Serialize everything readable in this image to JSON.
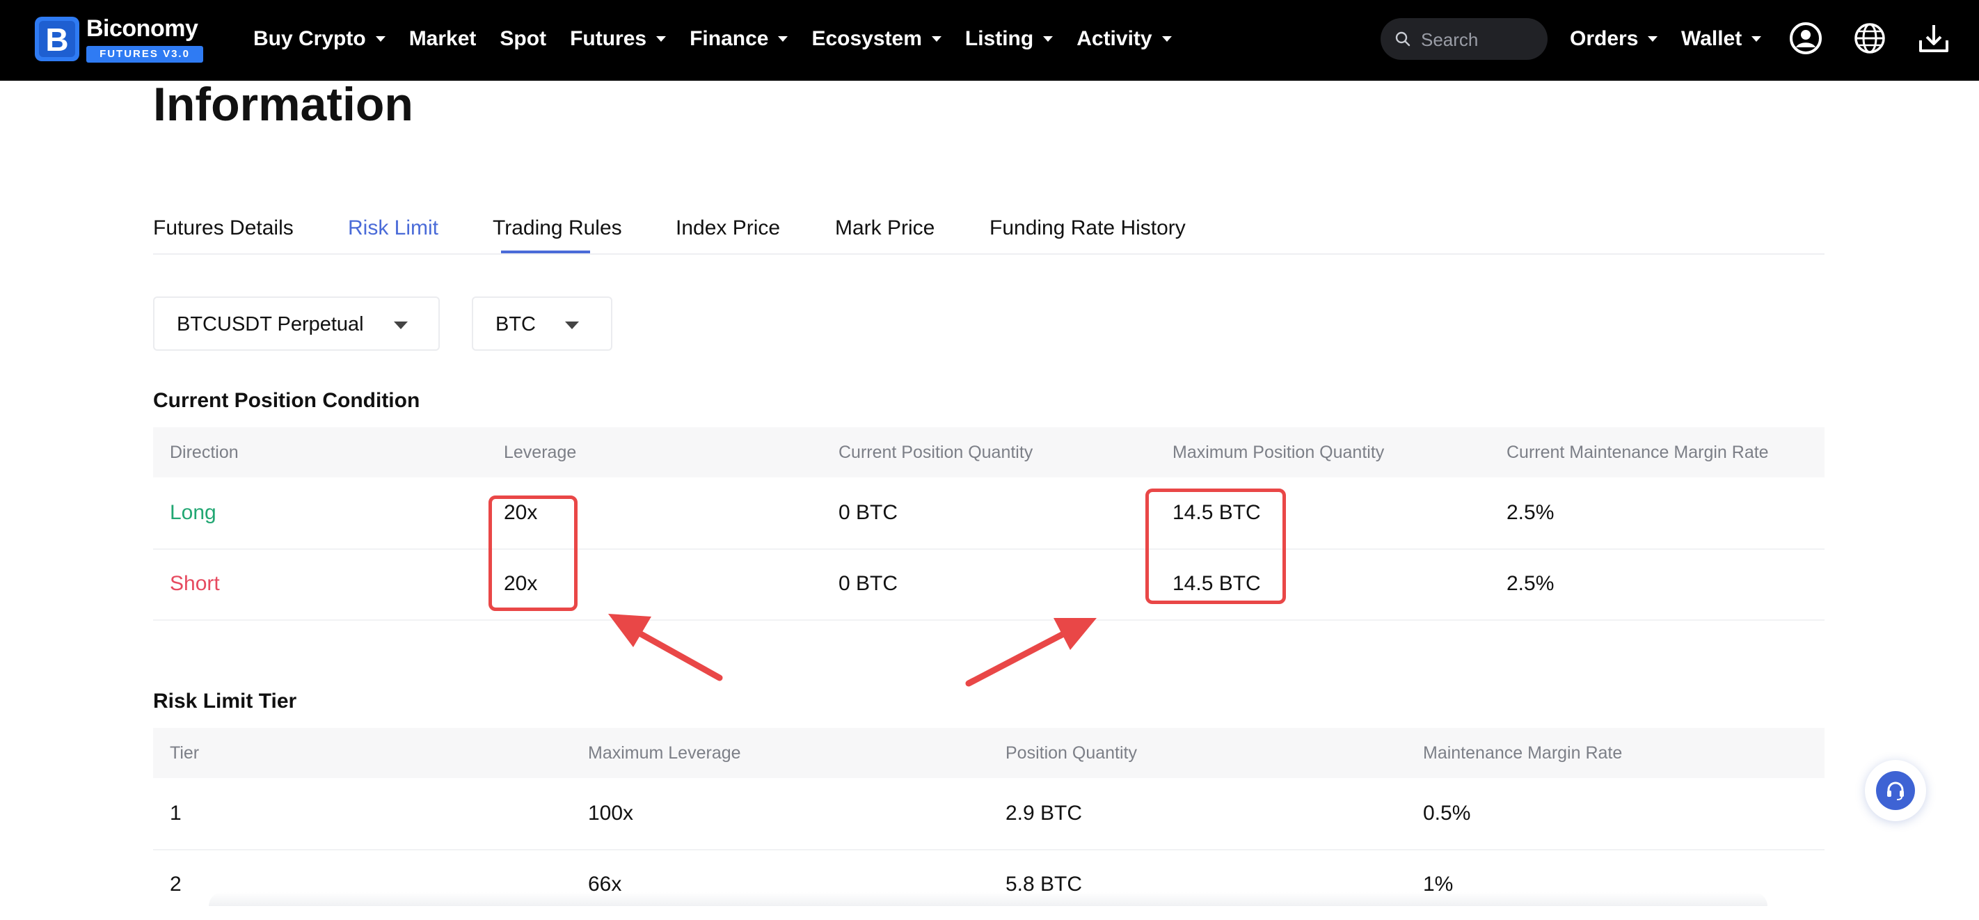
{
  "nav": {
    "brand": "Biconomy",
    "badge": "FUTURES V3.0",
    "menu": [
      {
        "label": "Buy Crypto",
        "dropdown": true
      },
      {
        "label": "Market",
        "dropdown": false
      },
      {
        "label": "Spot",
        "dropdown": false
      },
      {
        "label": "Futures",
        "dropdown": true
      },
      {
        "label": "Finance",
        "dropdown": true
      },
      {
        "label": "Ecosystem",
        "dropdown": true
      },
      {
        "label": "Listing",
        "dropdown": true
      },
      {
        "label": "Activity",
        "dropdown": true
      }
    ],
    "search_placeholder": "Search",
    "orders_label": "Orders",
    "wallet_label": "Wallet"
  },
  "page": {
    "title": "Information",
    "tabs": [
      {
        "label": "Futures Details",
        "active": false
      },
      {
        "label": "Risk Limit",
        "active": true
      },
      {
        "label": "Trading Rules",
        "active": false
      },
      {
        "label": "Index Price",
        "active": false
      },
      {
        "label": "Mark Price",
        "active": false
      },
      {
        "label": "Funding Rate History",
        "active": false
      }
    ],
    "contract_select": "BTCUSDT Perpetual",
    "unit_select": "BTC"
  },
  "current_position": {
    "title": "Current Position Condition",
    "columns": [
      "Direction",
      "Leverage",
      "Current Position Quantity",
      "Maximum Position Quantity",
      "Current Maintenance Margin Rate"
    ],
    "rows": [
      {
        "direction": "Long",
        "leverage": "20x",
        "current_qty": "0 BTC",
        "max_qty": "14.5 BTC",
        "margin_rate": "2.5%"
      },
      {
        "direction": "Short",
        "leverage": "20x",
        "current_qty": "0 BTC",
        "max_qty": "14.5 BTC",
        "margin_rate": "2.5%"
      }
    ]
  },
  "risk_tier": {
    "title": "Risk Limit Tier",
    "columns": [
      "Tier",
      "Maximum Leverage",
      "Position Quantity",
      "Maintenance Margin Rate"
    ],
    "rows": [
      {
        "tier": "1",
        "max_leverage": "100x",
        "qty": "2.9 BTC",
        "margin_rate": "0.5%"
      },
      {
        "tier": "2",
        "max_leverage": "66x",
        "qty": "5.8 BTC",
        "margin_rate": "1%"
      }
    ]
  },
  "colors": {
    "accent": "#4a6bd8",
    "long": "#22a773",
    "short": "#e64a5f",
    "annotation": "#e94747"
  },
  "icons": [
    "search-icon",
    "user-icon",
    "globe-icon",
    "download-icon",
    "headset-icon"
  ]
}
